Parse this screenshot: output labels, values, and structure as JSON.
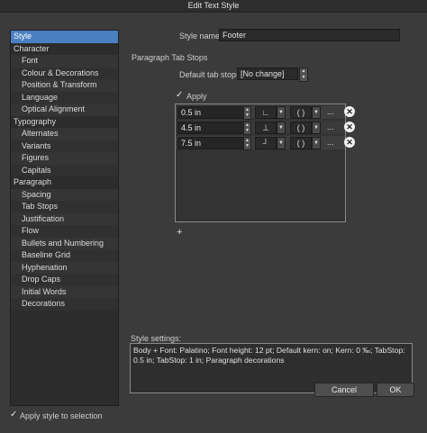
{
  "window": {
    "title": "Edit Text Style"
  },
  "sidebar": {
    "items": [
      {
        "label": "Style",
        "level": 0,
        "selected": true
      },
      {
        "label": "Character",
        "level": 0
      },
      {
        "label": "Font",
        "level": 1
      },
      {
        "label": "Colour & Decorations",
        "level": 1
      },
      {
        "label": "Position & Transform",
        "level": 1
      },
      {
        "label": "Language",
        "level": 1
      },
      {
        "label": "Optical Alignment",
        "level": 1
      },
      {
        "label": "Typography",
        "level": 0
      },
      {
        "label": "Alternates",
        "level": 1
      },
      {
        "label": "Variants",
        "level": 1
      },
      {
        "label": "Figures",
        "level": 1
      },
      {
        "label": "Capitals",
        "level": 1
      },
      {
        "label": "Paragraph",
        "level": 0
      },
      {
        "label": "Spacing",
        "level": 1
      },
      {
        "label": "Tab Stops",
        "level": 1
      },
      {
        "label": "Justification",
        "level": 1
      },
      {
        "label": "Flow",
        "level": 1
      },
      {
        "label": "Bullets and Numbering",
        "level": 1
      },
      {
        "label": "Baseline Grid",
        "level": 1
      },
      {
        "label": "Hyphenation",
        "level": 1
      },
      {
        "label": "Drop Caps",
        "level": 1
      },
      {
        "label": "Initial Words",
        "level": 1
      },
      {
        "label": "Decorations",
        "level": 1
      }
    ]
  },
  "style_name": {
    "label": "Style name:",
    "value": "Footer"
  },
  "tab_stops": {
    "section_label": "Paragraph Tab Stops",
    "default_label": "Default tab stops:",
    "default_value": "[No change]",
    "apply_label": "Apply",
    "apply_checked": true,
    "rows": [
      {
        "position": "0.5 in",
        "alignment": "∟",
        "leader": "( )",
        "more": "..."
      },
      {
        "position": "4.5 in",
        "alignment": "⊥",
        "leader": "( )",
        "more": "..."
      },
      {
        "position": "7.5 in",
        "alignment": "┘",
        "leader": "( )",
        "more": "..."
      }
    ],
    "add_icon": "add-tab-stop-icon"
  },
  "settings": {
    "label": "Style settings:",
    "text": "Body + Font: Palatino; Font height: 12 pt; Default kern: on; Kern: 0 ‰; TabStop: 0.5 in; TabStop: 1 in; Paragraph decorations"
  },
  "footer": {
    "apply_selection_label": "Apply style to selection",
    "apply_selection_checked": true,
    "cancel_label": "Cancel",
    "ok_label": "OK"
  }
}
